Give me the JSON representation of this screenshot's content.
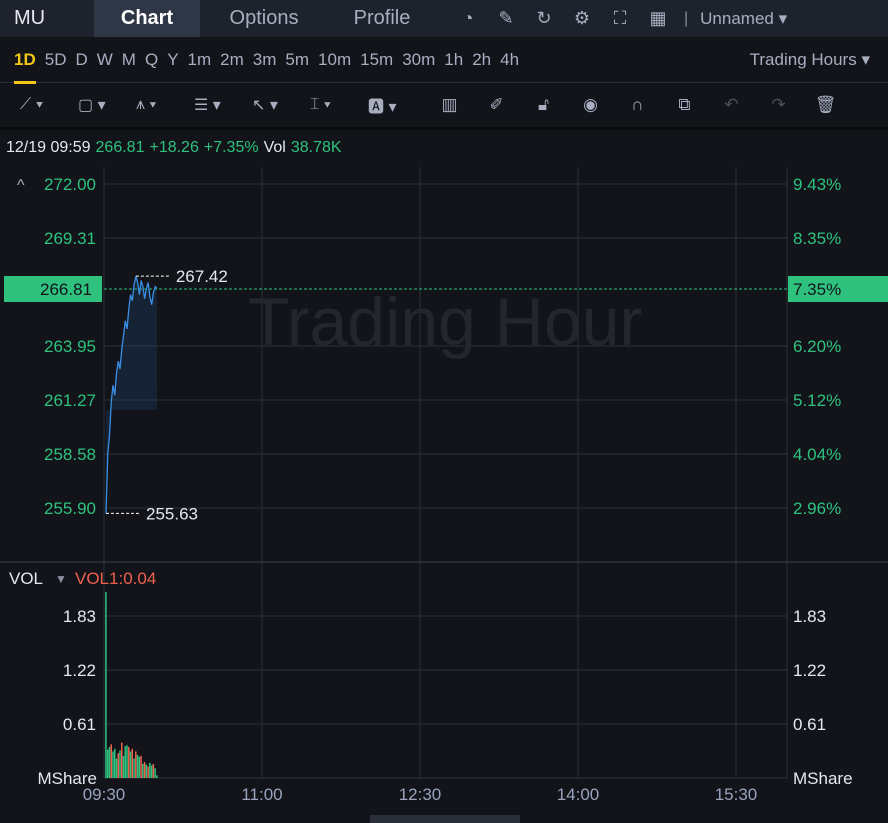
{
  "header": {
    "symbol": "MU",
    "tabs": [
      {
        "label": "Chart",
        "active": true
      },
      {
        "label": "Options"
      },
      {
        "label": "Profile"
      }
    ],
    "icons": [
      "gauge-icon",
      "edit-icon",
      "refresh-icon",
      "gear-icon",
      "fullscreen-icon",
      "grid-icon"
    ],
    "layout_name": "Unnamed"
  },
  "periods": {
    "items": [
      "1D",
      "5D",
      "D",
      "W",
      "M",
      "Q",
      "Y",
      "1m",
      "2m",
      "3m",
      "5m",
      "10m",
      "15m",
      "30m",
      "1h",
      "2h",
      "4h"
    ],
    "active": "1D",
    "session": "Trading Hours"
  },
  "quote": {
    "datetime": "12/19 09:59",
    "price": "266.81",
    "change": "+18.26",
    "change_pct": "+7.35%",
    "vol_label": "Vol",
    "volume": "38.78K"
  },
  "chart": {
    "watermark": "Trading Hour",
    "current_price": "266.81",
    "current_pct": "7.35%",
    "high_label": "267.42",
    "low_label": "255.63",
    "price_ticks": [
      "272.00",
      "269.31",
      "263.95",
      "261.27",
      "258.58",
      "255.90"
    ],
    "pct_ticks": [
      "9.43%",
      "8.35%",
      "6.20%",
      "5.12%",
      "4.04%",
      "2.96%"
    ],
    "time_ticks": [
      "09:30",
      "11:00",
      "12:30",
      "14:00",
      "15:30"
    ],
    "vol_label": "VOL",
    "vol_indicator": "VOL1:0.04",
    "vol_ticks": [
      "1.83",
      "1.22",
      "0.61"
    ],
    "vol_unit": "MShare"
  },
  "chart_data": {
    "type": "line",
    "xlabel": "",
    "ylabel": "",
    "ylim": [
      255.9,
      272.0
    ],
    "price_minutes": [
      0,
      1,
      2,
      3,
      4,
      5,
      6,
      7,
      8,
      9,
      10,
      11,
      12,
      13,
      14,
      15,
      16,
      17,
      18,
      19,
      20,
      21,
      22,
      23,
      24,
      25,
      26,
      27,
      28,
      29
    ],
    "price": [
      255.63,
      258.6,
      259.5,
      261.2,
      262.0,
      261.5,
      262.6,
      263.2,
      262.8,
      263.8,
      264.5,
      265.2,
      264.8,
      265.8,
      266.5,
      266.2,
      267.0,
      267.42,
      267.1,
      266.5,
      267.2,
      266.9,
      266.3,
      266.8,
      267.1,
      266.4,
      266.0,
      266.6,
      266.9,
      266.81
    ],
    "volume_M": [
      2.1,
      0.32,
      0.35,
      0.38,
      0.3,
      0.33,
      0.22,
      0.28,
      0.31,
      0.4,
      0.25,
      0.36,
      0.37,
      0.35,
      0.3,
      0.33,
      0.22,
      0.3,
      0.26,
      0.24,
      0.25,
      0.16,
      0.18,
      0.15,
      0.13,
      0.17,
      0.14,
      0.16,
      0.11,
      0.03
    ],
    "volume_up": [
      1,
      1,
      1,
      0,
      1,
      1,
      1,
      0,
      1,
      0,
      1,
      1,
      1,
      0,
      1,
      0,
      1,
      0,
      1,
      1,
      0,
      1,
      0,
      1,
      0,
      1,
      1,
      0,
      1,
      1
    ]
  }
}
